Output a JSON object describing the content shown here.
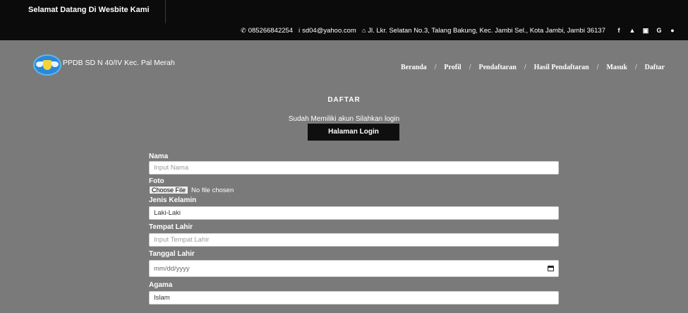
{
  "topbar": {
    "welcome": "Selamat Datang Di Wesbite Kami",
    "phone": "085266842254",
    "email": "sd04@yahoo.com",
    "address": "Jl. Lkr. Selatan No.3, Talang Bakung, Kec. Jambi Sel., Kota Jambi, Jambi 36137",
    "social": [
      "f",
      "t",
      "ig",
      "G",
      "gh"
    ]
  },
  "brand": {
    "name": "PPDB SD N 40/IV Kec. Pal Merah"
  },
  "nav": {
    "items": [
      "Beranda",
      "Profil",
      "Pendaftaran",
      "Hasil Pendaftaran",
      "Masuk",
      "Daftar"
    ],
    "separator": "/"
  },
  "page": {
    "title": "DAFTAR",
    "hint": "Sudah Memiliki akun Silahkan login",
    "login_button": "Halaman Login"
  },
  "form": {
    "nama": {
      "label": "Nama",
      "placeholder": "Input Nama"
    },
    "foto": {
      "label": "Foto",
      "button": "Choose File",
      "status": "No file chosen"
    },
    "jenis_kelamin": {
      "label": "Jenis Kelamin",
      "value": "Laki-Laki"
    },
    "tempat_lahir": {
      "label": "Tempat Lahir",
      "placeholder": "Input Tempat Lahir"
    },
    "tanggal_lahir": {
      "label": "Tanggal Lahir",
      "placeholder": "mm/dd/yyyy"
    },
    "agama": {
      "label": "Agama",
      "value": "Islam"
    }
  },
  "colors": {
    "topbar": "#0b0b0b",
    "background": "#7a7a7a",
    "button": "#0f0f0f"
  }
}
